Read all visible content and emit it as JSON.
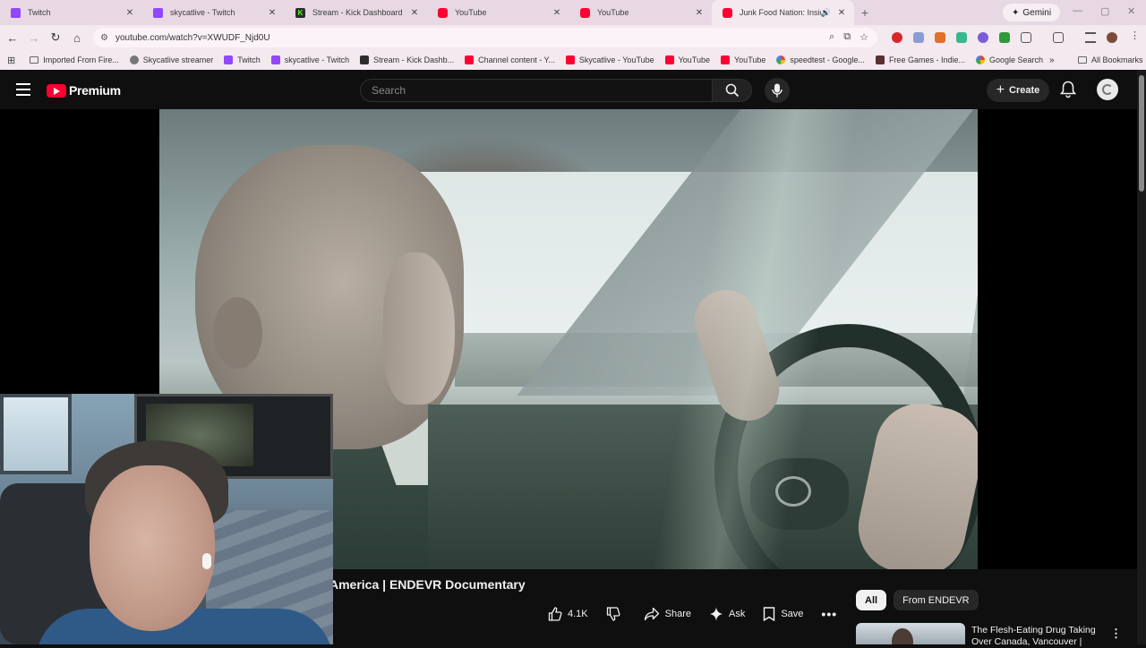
{
  "browser": {
    "tabs": [
      {
        "title": "Twitch",
        "favicon": "twitch-icon",
        "active": false
      },
      {
        "title": "skycatlive - Twitch",
        "favicon": "twitch-icon",
        "active": false
      },
      {
        "title": "Stream - Kick Dashboard",
        "favicon": "kick-icon",
        "active": false
      },
      {
        "title": "YouTube",
        "favicon": "youtube-icon",
        "active": false
      },
      {
        "title": "YouTube",
        "favicon": "youtube-icon",
        "active": false
      },
      {
        "title": "Junk Food Nation: Inside T",
        "favicon": "youtube-icon",
        "active": true,
        "audio": true
      }
    ],
    "gemini_label": "Gemini",
    "url": "youtube.com/watch?v=XWUDF_Njd0U",
    "bookmarks": [
      {
        "label": "Imported From Fire...",
        "icon": "folder-icon"
      },
      {
        "label": "Skycatlive streamer",
        "icon": "bookmark-icon"
      },
      {
        "label": "Twitch",
        "icon": "twitch-icon"
      },
      {
        "label": "skycatlive - Twitch",
        "icon": "twitch-icon"
      },
      {
        "label": "Stream - Kick Dashb...",
        "icon": "kick-icon"
      },
      {
        "label": "Channel content - Y...",
        "icon": "youtube-icon"
      },
      {
        "label": "Skycatlive - YouTube",
        "icon": "youtube-icon"
      },
      {
        "label": "YouTube",
        "icon": "youtube-icon"
      },
      {
        "label": "YouTube",
        "icon": "youtube-icon"
      },
      {
        "label": "speedtest - Google...",
        "icon": "google-icon"
      },
      {
        "label": "Free Games - Indie...",
        "icon": "itch-icon"
      },
      {
        "label": "Google Search",
        "icon": "google-icon"
      }
    ],
    "all_bookmarks_label": "All Bookmarks"
  },
  "youtube": {
    "logo_text": "Premium",
    "search_placeholder": "Search",
    "create_label": "Create",
    "video": {
      "title": "America | ENDEVR Documentary",
      "likes": "4.1K",
      "share_label": "Share",
      "ask_label": "Ask",
      "save_label": "Save"
    },
    "chips": [
      "All",
      "From ENDEVR"
    ],
    "recommendation": {
      "title": "The Flesh-Eating Drug Taking Over Canada, Vancouver |"
    }
  },
  "colors": {
    "youtube_red": "#ff0033",
    "twitch_purple": "#9146ff",
    "kick_green": "#53fc18",
    "page_bg": "#0f0f0f",
    "browser_chrome": "#f3e9ef"
  }
}
